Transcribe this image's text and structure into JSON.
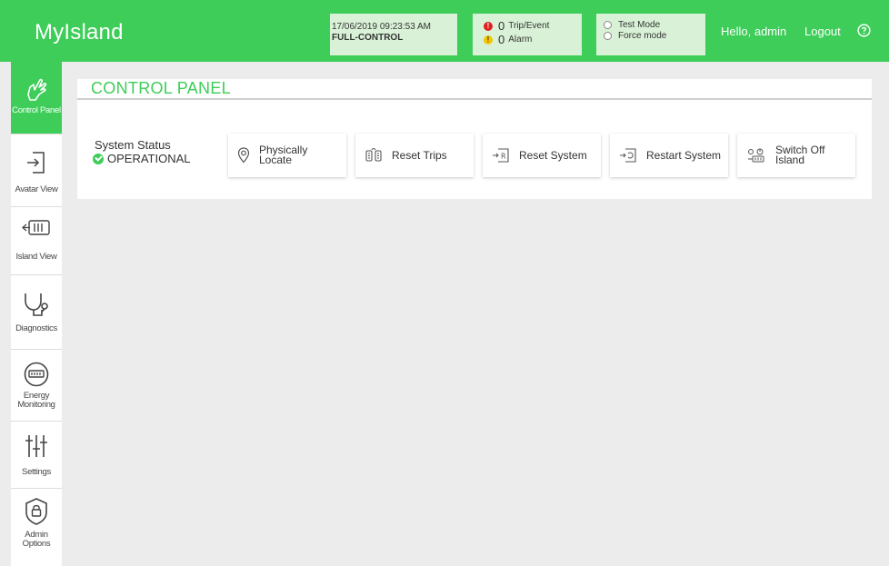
{
  "app": {
    "title": "MyIsland"
  },
  "header": {
    "datetime": "17/06/2019 09:23:53 AM",
    "control_mode": "FULL-CONTROL",
    "trip_count": "0",
    "trip_label": "Trip/Event",
    "alarm_count": "0",
    "alarm_label": "Alarm",
    "test_mode_label": "Test Mode",
    "force_mode_label": "Force mode",
    "greeting": "Hello, admin",
    "logout_label": "Logout"
  },
  "sidebar": {
    "items": [
      {
        "label": "Control Panel",
        "icon": "hand-pointer-icon",
        "active": true
      },
      {
        "label": "Avatar View",
        "icon": "enter-arrow-icon"
      },
      {
        "label": "Island View",
        "icon": "island-modules-icon"
      },
      {
        "label": "Diagnostics",
        "icon": "stethoscope-icon"
      },
      {
        "label": "Energy Monitoring",
        "icon": "energy-meter-icon"
      },
      {
        "label": "Settings",
        "icon": "sliders-icon"
      },
      {
        "label": "Admin Options",
        "icon": "shield-lock-icon"
      }
    ]
  },
  "main": {
    "title": "CONTROL PANEL",
    "system_status_label": "System Status",
    "system_status_value": "OPERATIONAL",
    "actions": [
      {
        "label": "Physically Locate",
        "icon": "location-pin-icon"
      },
      {
        "label": "Reset Trips",
        "icon": "reset-trips-icon"
      },
      {
        "label": "Reset System",
        "icon": "reset-system-icon"
      },
      {
        "label": "Restart System",
        "icon": "restart-system-icon"
      },
      {
        "label": "Switch Off Island",
        "icon": "switch-off-icon"
      }
    ]
  },
  "colors": {
    "brand_green": "#3dcd58",
    "header_box": "#d9f2d7",
    "trip_red": "#e02020",
    "alarm_yellow": "#f5c500"
  }
}
